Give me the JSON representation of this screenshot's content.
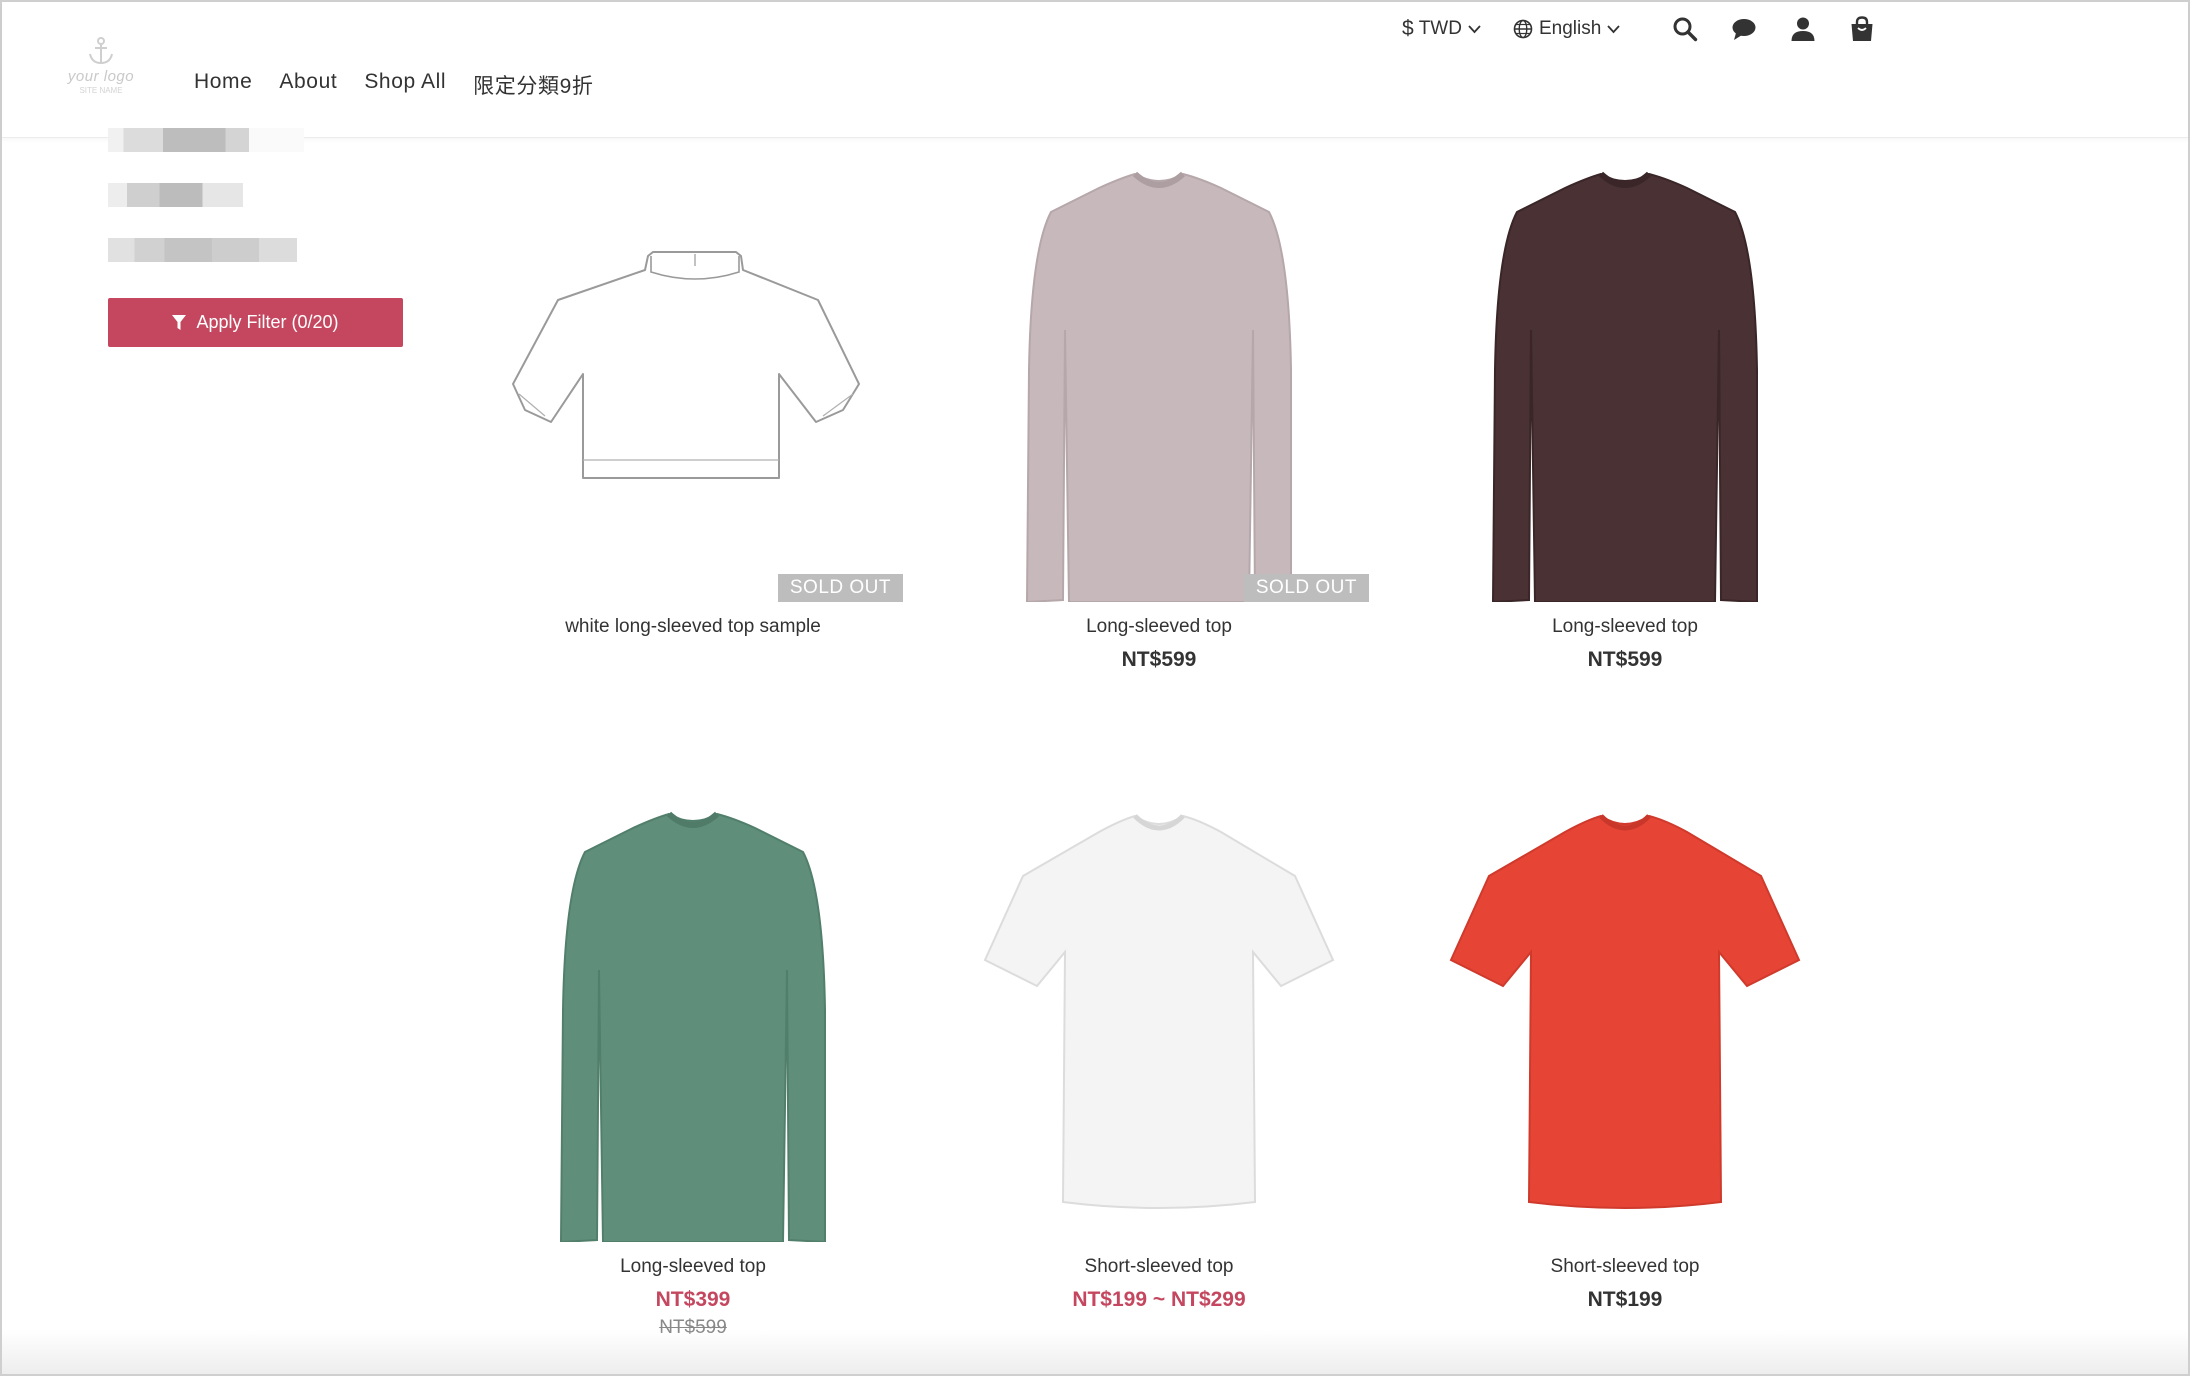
{
  "header": {
    "logo": {
      "text": "your logo",
      "subtext": "SITE NAME"
    },
    "nav": [
      "Home",
      "About",
      "Shop All",
      "限定分類9折"
    ],
    "currency": {
      "symbol": "$",
      "label": "TWD"
    },
    "language": {
      "label": "English"
    },
    "icons": [
      "search-icon",
      "chat-icon",
      "user-icon",
      "cart-icon"
    ]
  },
  "sidebar": {
    "filter_button": "Apply Filter (0/20)"
  },
  "products": [
    {
      "name": "white long-sleeved top sample",
      "price": "",
      "original_price": "",
      "badge": "SOLD OUT",
      "shirt": "sketch"
    },
    {
      "name": "Long-sleeved top",
      "price": "NT$599",
      "original_price": "",
      "badge": "SOLD OUT",
      "shirt": "long",
      "color": "#c7b9bb"
    },
    {
      "name": "Long-sleeved top",
      "price": "NT$599",
      "original_price": "",
      "badge": "",
      "shirt": "long",
      "color": "#4a3133"
    },
    {
      "name": "Long-sleeved top",
      "price": "NT$399",
      "original_price": "NT$599",
      "badge": "",
      "shirt": "long",
      "color": "#5f8f7b"
    },
    {
      "name": "Short-sleeved top",
      "price": "NT$199 ~ NT$299",
      "original_price": "",
      "badge": "",
      "shirt": "short",
      "color": "#f4f4f4"
    },
    {
      "name": "Short-sleeved top",
      "price": "NT$199",
      "original_price": "",
      "badge": "",
      "shirt": "short",
      "color": "#e64536"
    }
  ],
  "colors": {
    "accent": "#c4475f",
    "sold_out_badge": "#bdbdbd"
  }
}
